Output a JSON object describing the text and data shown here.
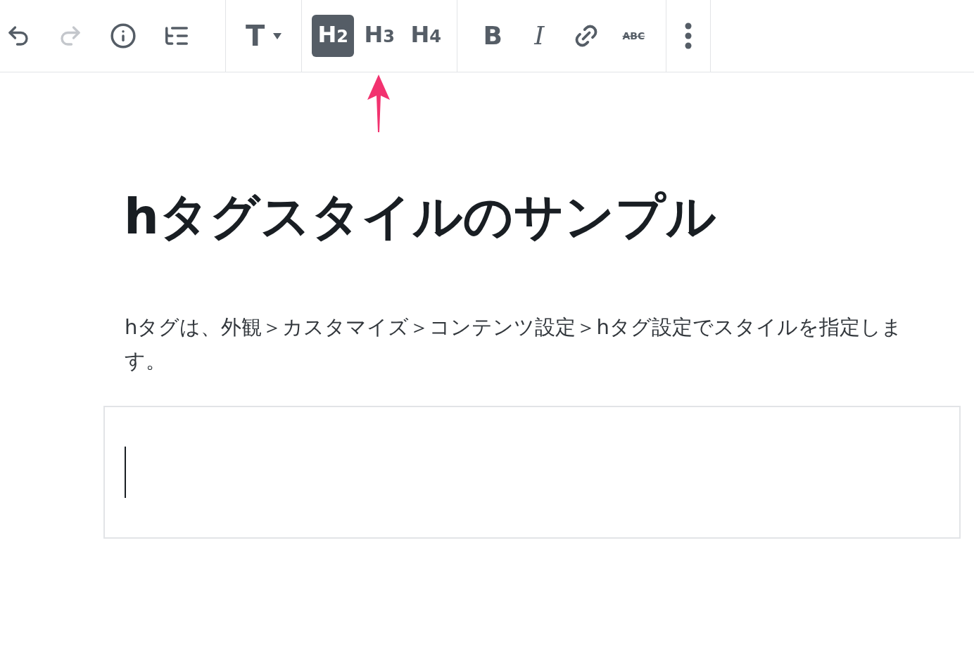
{
  "toolbar": {
    "history": [
      {
        "kind": "undo",
        "disabled": false
      },
      {
        "kind": "redo",
        "disabled": true
      }
    ],
    "tools": [
      {
        "kind": "info"
      },
      {
        "kind": "outline"
      }
    ],
    "block_type": {
      "label": "T"
    },
    "heading_levels": [
      {
        "label": "H2",
        "selected": true
      },
      {
        "label": "H3",
        "selected": false
      },
      {
        "label": "H4",
        "selected": false
      }
    ],
    "formats": [
      {
        "kind": "bold",
        "label": "B"
      },
      {
        "kind": "italic",
        "label": "I"
      },
      {
        "kind": "link"
      },
      {
        "kind": "strikethrough",
        "label": "ABC"
      }
    ]
  },
  "content": {
    "title": "hタグスタイルのサンプル",
    "paragraph": "hタグは、外観＞カスタマイズ＞コンテンツ設定＞hタグ設定でスタイルを指定します。",
    "empty_block": {
      "cursor": true
    }
  }
}
